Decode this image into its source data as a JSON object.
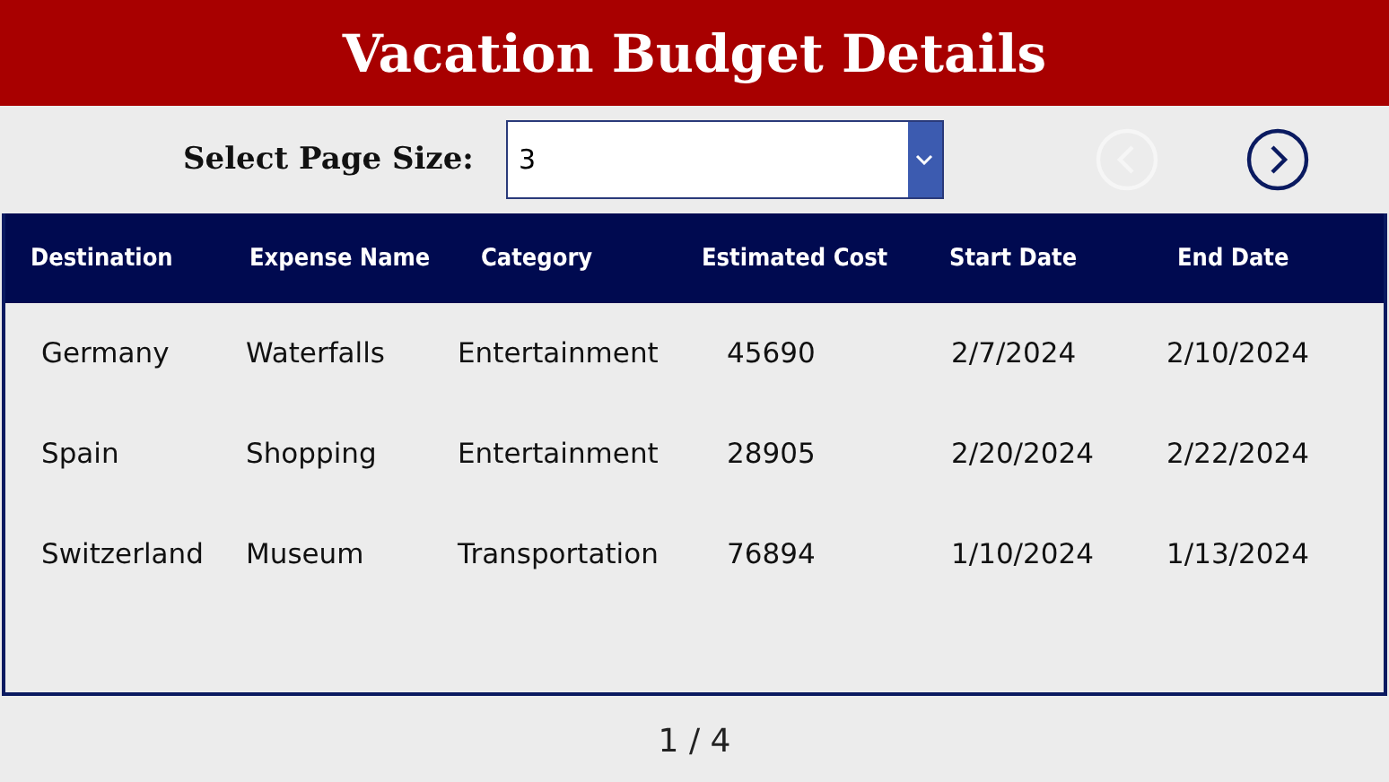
{
  "title": "Vacation Budget Details",
  "page_size": {
    "label": "Select Page Size:",
    "value": "3"
  },
  "pager": {
    "prev": {
      "disabled": true
    },
    "next": {
      "disabled": false
    },
    "page_label": "1 / 4"
  },
  "table": {
    "columns": [
      "Destination",
      "Expense Name",
      "Category",
      "Estimated Cost",
      "Start Date",
      "End Date"
    ],
    "rows": [
      [
        "Germany",
        "Waterfalls",
        "Entertainment",
        "45690",
        "2/7/2024",
        "2/10/2024"
      ],
      [
        "Spain",
        "Shopping",
        "Entertainment",
        "28905",
        "2/20/2024",
        "2/22/2024"
      ],
      [
        "Switzerland",
        "Museum",
        "Transportation",
        "76894",
        "1/10/2024",
        "1/13/2024"
      ]
    ]
  }
}
